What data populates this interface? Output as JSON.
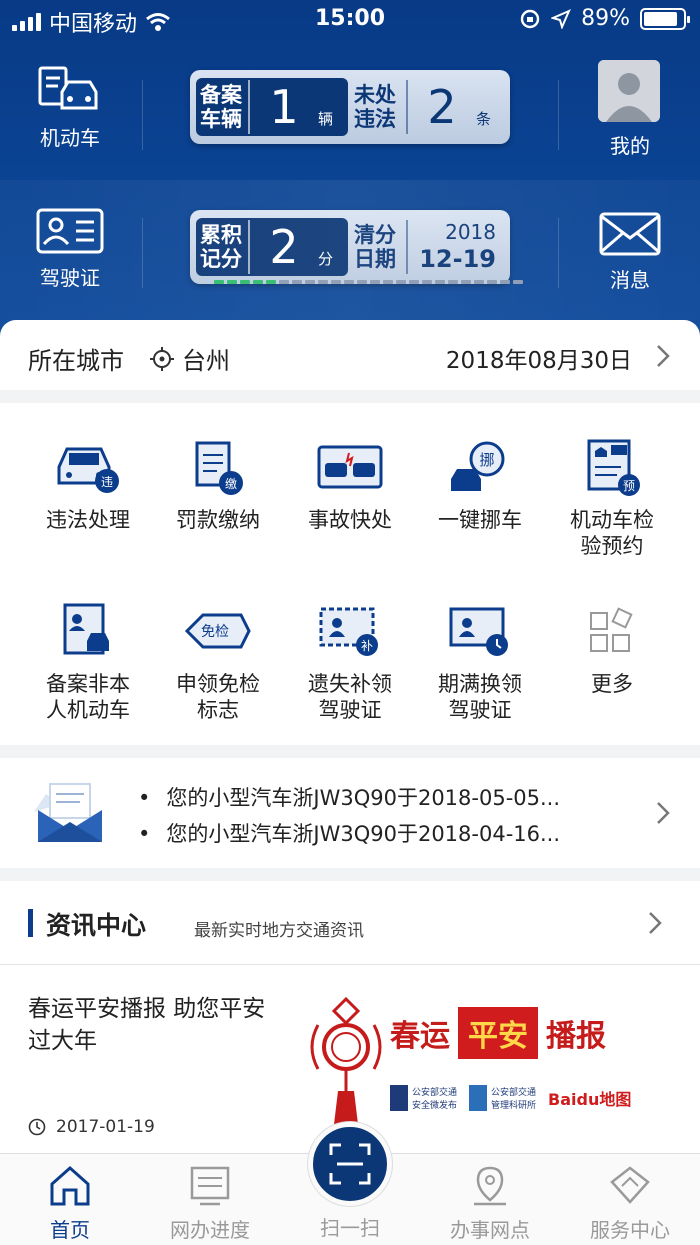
{
  "status_bar": {
    "carrier": "中国移动",
    "time": "15:00",
    "battery": "89%"
  },
  "header": {
    "vehicle_label": "机动车",
    "license_label": "驾驶证",
    "me_label": "我的",
    "messages_label": "消息",
    "plate1": {
      "left_label": "备案\n车辆",
      "left_value": "1",
      "left_unit": "辆",
      "right_label": "未处\n违法",
      "right_value": "2",
      "right_unit": "条"
    },
    "plate2": {
      "left_label": "累积\n记分",
      "left_value": "2",
      "left_unit": "分",
      "right_label": "清分\n日期",
      "date_year": "2018",
      "date_md": "12-19",
      "score_progress": 0.2
    }
  },
  "city_row": {
    "label": "所在城市",
    "city": "台州",
    "date": "2018年08月30日"
  },
  "services": [
    {
      "label": "违法处理",
      "icon": "violation-car-icon"
    },
    {
      "label": "罚款缴纳",
      "icon": "fine-payment-icon"
    },
    {
      "label": "事故快处",
      "icon": "accident-icon"
    },
    {
      "label": "一键挪车",
      "icon": "move-car-icon"
    },
    {
      "label": "机动车检\n验预约",
      "icon": "inspection-icon"
    },
    {
      "label": "备案非本\n人机动车",
      "icon": "register-vehicle-icon"
    },
    {
      "label": "申领免检\n标志",
      "icon": "exempt-sign-icon"
    },
    {
      "label": "遗失补领\n驾驶证",
      "icon": "reissue-license-icon"
    },
    {
      "label": "期满换领\n驾驶证",
      "icon": "renew-license-icon"
    },
    {
      "label": "更多",
      "icon": "more-icon"
    }
  ],
  "notices": [
    "您的小型汽车浙JW3Q90于2018-05-05...",
    "您的小型汽车浙JW3Q90于2018-04-16..."
  ],
  "news": {
    "title": "资讯中心",
    "subtitle": "最新实时地方交通资讯",
    "article": {
      "title": "春运平安播报 助您平安过大年",
      "date": "2017-01-19",
      "banner_text": "春运平安播报",
      "banner_chars": [
        "春运",
        "平安",
        "播报"
      ],
      "logo_text_1": "公安部交通\n安全微发布",
      "logo_text_2": "公安部交通\n管理科研所",
      "logo_text_3": "Baidu地图"
    }
  },
  "tabs": [
    {
      "label": "首页",
      "active": true
    },
    {
      "label": "网办进度",
      "active": false
    },
    {
      "label": "扫一扫",
      "active": false
    },
    {
      "label": "办事网点",
      "active": false
    },
    {
      "label": "服务中心",
      "active": false
    }
  ],
  "colors": {
    "brand": "#0c3d8c",
    "green": "#2dbb6b",
    "red": "#d01c1c"
  }
}
